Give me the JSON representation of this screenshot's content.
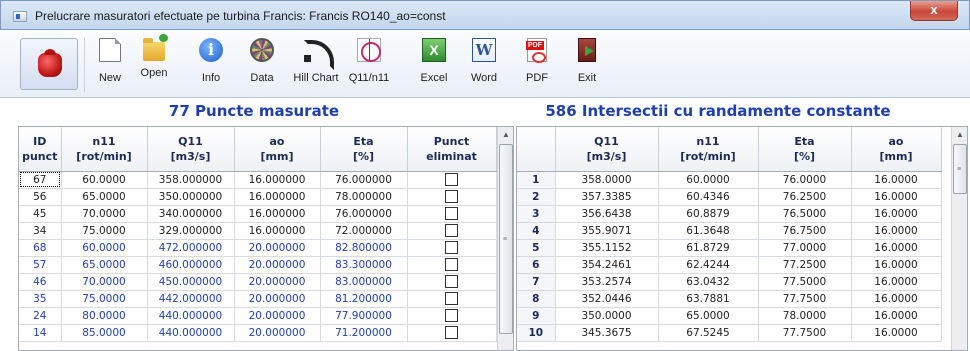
{
  "window": {
    "title": "Prelucrare masuratori efectuate pe turbina Francis: Francis RO140_ao=const",
    "close_label": "x"
  },
  "toolbar": {
    "buttons": [
      {
        "label": "New",
        "icon": "new-document-icon"
      },
      {
        "label": "Open",
        "icon": "open-folder-icon"
      },
      {
        "label": "Info",
        "icon": "info-icon"
      },
      {
        "label": "Data",
        "icon": "data-icon"
      },
      {
        "label": "Hill Chart",
        "icon": "hill-chart-icon"
      },
      {
        "label": "Q11/n11",
        "icon": "q11-n11-icon"
      },
      {
        "label": "Excel",
        "icon": "excel-icon"
      },
      {
        "label": "Word",
        "icon": "word-icon"
      },
      {
        "label": "PDF",
        "icon": "pdf-icon"
      },
      {
        "label": "Exit",
        "icon": "exit-icon"
      }
    ]
  },
  "left_panel": {
    "title": "77 Puncte masurate",
    "headers": [
      "ID\npunct",
      "n11\n[rot/min]",
      "Q11\n[m3/s]",
      "ao\n[mm]",
      "Eta\n[%]",
      "Punct\neliminat"
    ],
    "rows": [
      [
        "67",
        "60.0000",
        "358.000000",
        "16.000000",
        "76.000000"
      ],
      [
        "56",
        "65.0000",
        "350.000000",
        "16.000000",
        "78.000000"
      ],
      [
        "45",
        "70.0000",
        "340.000000",
        "16.000000",
        "76.000000"
      ],
      [
        "34",
        "75.0000",
        "329.000000",
        "16.000000",
        "72.000000"
      ],
      [
        "68",
        "60.0000",
        "472.000000",
        "20.000000",
        "82.800000"
      ],
      [
        "57",
        "65.0000",
        "460.000000",
        "20.000000",
        "83.300000"
      ],
      [
        "46",
        "70.0000",
        "450.000000",
        "20.000000",
        "83.000000"
      ],
      [
        "35",
        "75.0000",
        "442.000000",
        "20.000000",
        "81.200000"
      ],
      [
        "24",
        "80.0000",
        "440.000000",
        "20.000000",
        "77.900000"
      ],
      [
        "14",
        "85.0000",
        "440.000000",
        "20.000000",
        "71.200000"
      ]
    ]
  },
  "right_panel": {
    "title": "586 Intersectii cu randamente constante",
    "headers": [
      "",
      "Q11\n[m3/s]",
      "n11\n[rot/min]",
      "Eta\n[%]",
      "ao\n[mm]"
    ],
    "rows": [
      [
        "1",
        "358.0000",
        "60.0000",
        "76.0000",
        "16.0000"
      ],
      [
        "2",
        "357.3385",
        "60.4346",
        "76.2500",
        "16.0000"
      ],
      [
        "3",
        "356.6438",
        "60.8879",
        "76.5000",
        "16.0000"
      ],
      [
        "4",
        "355.9071",
        "61.3648",
        "76.7500",
        "16.0000"
      ],
      [
        "5",
        "355.1152",
        "61.8729",
        "77.0000",
        "16.0000"
      ],
      [
        "6",
        "354.2461",
        "62.4244",
        "77.2500",
        "16.0000"
      ],
      [
        "7",
        "353.2574",
        "63.0432",
        "77.5000",
        "16.0000"
      ],
      [
        "8",
        "352.0446",
        "63.7881",
        "77.7500",
        "16.0000"
      ],
      [
        "9",
        "350.0000",
        "65.0000",
        "78.0000",
        "16.0000"
      ],
      [
        "10",
        "345.3675",
        "67.5245",
        "77.7500",
        "16.0000"
      ]
    ]
  }
}
